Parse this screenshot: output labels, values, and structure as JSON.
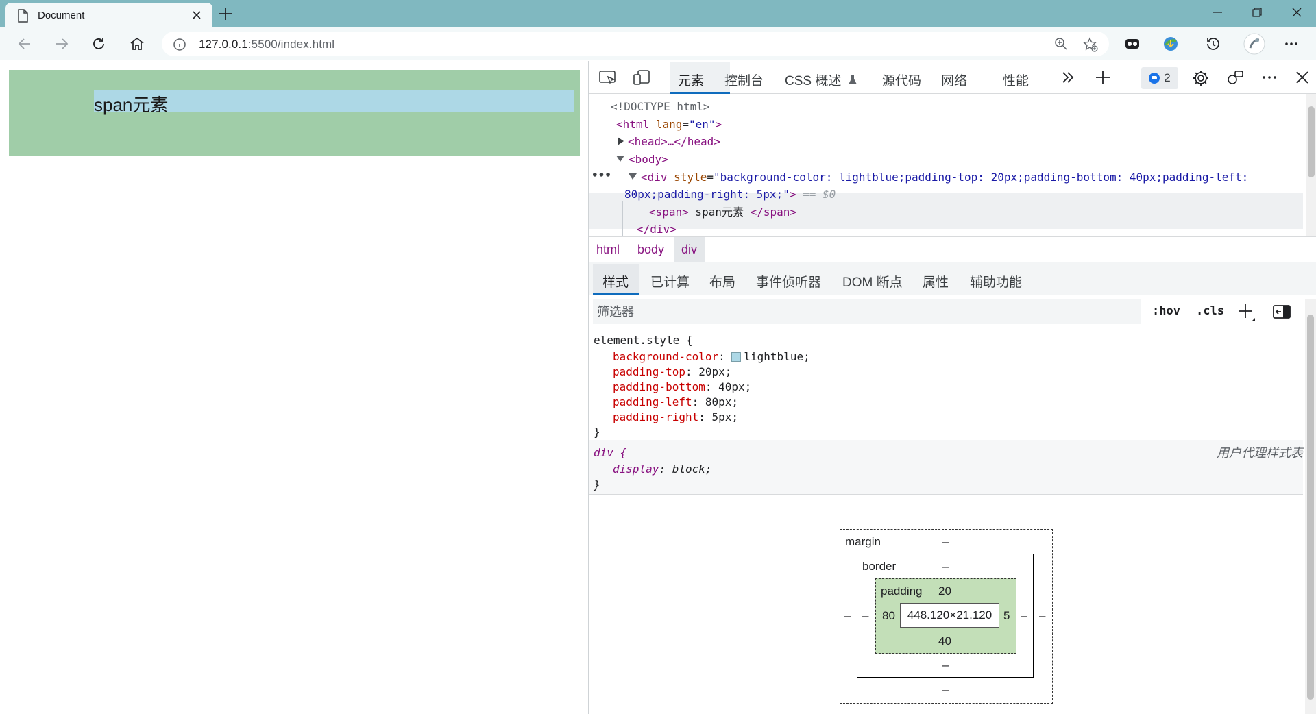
{
  "browser": {
    "tab_title": "Document",
    "new_tab_symbol": "+",
    "url_host": "127.0.0.1",
    "url_rest": ":5500/index.html"
  },
  "page": {
    "span_text": "span元素",
    "div_color": "#a0cda8",
    "span_color": "#add8e6"
  },
  "devtools": {
    "tabs": [
      "元素",
      "控制台",
      "CSS 概述",
      "源代码",
      "网络",
      "性能"
    ],
    "issues_count": "2",
    "dom": {
      "doctype": "<!DOCTYPE html>",
      "html_open_tag": "<html",
      "html_lang_attr": "lang",
      "html_lang_val": "\"en\"",
      "html_close": ">",
      "head": "<head>…</head>",
      "body": "<body>",
      "div_tag": "<div",
      "div_style_attr": "style",
      "div_style_val_1": "\"background-color: lightblue;padding-top: 20px;padding-bottom: 40px;padding-left:",
      "div_style_val_2": "80px;padding-right: 5px;\"",
      "div_close": ">",
      "selected_marker": "== $0",
      "span_open": "<span>",
      "span_text": " span元素 ",
      "span_close": "</span>",
      "div_end": "</div>",
      "ellipsis": "•••"
    },
    "breadcrumb": [
      "html",
      "body",
      "div"
    ],
    "subtabs": [
      "样式",
      "已计算",
      "布局",
      "事件侦听器",
      "DOM 断点",
      "属性",
      "辅助功能"
    ],
    "filter_placeholder": "筛选器",
    "hov_label": ":hov",
    "cls_label": ".cls",
    "element_style": {
      "selector": "element.style {",
      "props": [
        {
          "name": "background-color",
          "value": "lightblue;",
          "swatch": true
        },
        {
          "name": "padding-top",
          "value": "20px;"
        },
        {
          "name": "padding-bottom",
          "value": "40px;"
        },
        {
          "name": "padding-left",
          "value": "80px;"
        },
        {
          "name": "padding-right",
          "value": "5px;"
        }
      ],
      "close": "}"
    },
    "ua_rule": {
      "selector": "div {",
      "prop_name": "display",
      "prop_value": "block;",
      "close": "}",
      "source": "用户代理样式表"
    },
    "box_model": {
      "margin_label": "margin",
      "margin_top": "–",
      "margin_left": "–",
      "margin_right": "–",
      "margin_bottom": "–",
      "border_label": "border",
      "border_top": "–",
      "border_left": "–",
      "border_right": "–",
      "border_bottom": "–",
      "padding_label": "padding",
      "padding_top": "20",
      "padding_left": "80",
      "padding_right": "5",
      "padding_bottom": "40",
      "content": "448.120×21.120"
    }
  }
}
